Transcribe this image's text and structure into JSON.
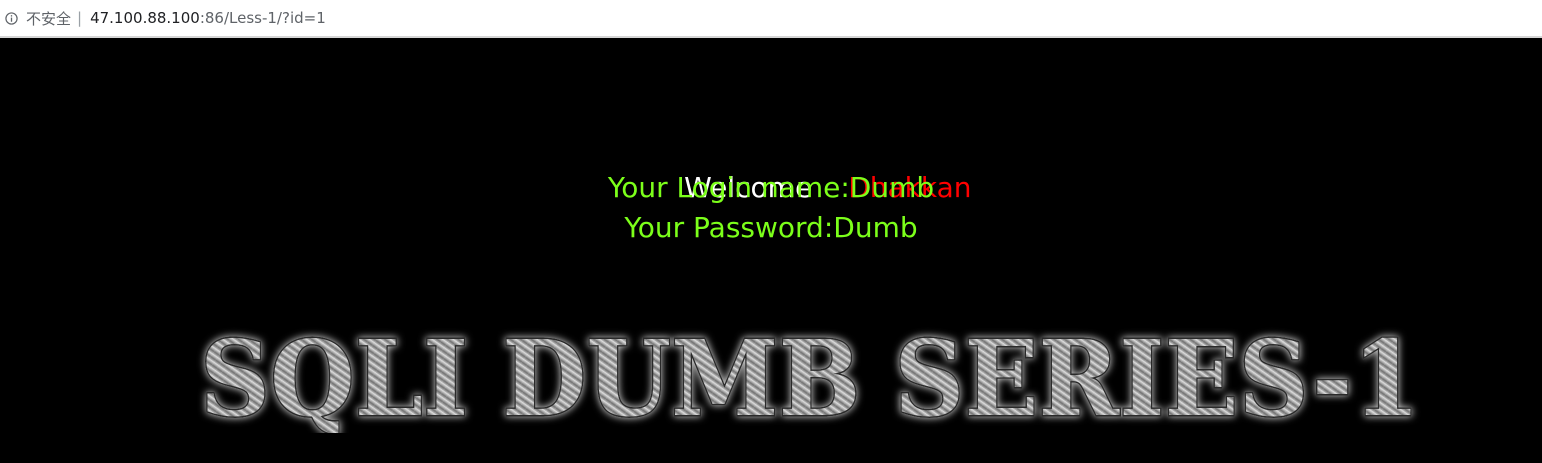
{
  "browser": {
    "security_label": "不安全",
    "separator": "|",
    "url_host": "47.100.88.100",
    "url_rest": ":86/Less-1/?id=1",
    "icon": "info-icon"
  },
  "page": {
    "welcome": "Welcome",
    "user_name": "Dhakkan",
    "login_line": "Your Login name:Dumb",
    "password_line": "Your Password:Dumb",
    "banner_text": "SQLI DUMB SERIES-1"
  },
  "colors": {
    "background": "#000000",
    "welcome": "#ffffff",
    "user_name": "#ff0000",
    "info": "#7cff1a"
  }
}
